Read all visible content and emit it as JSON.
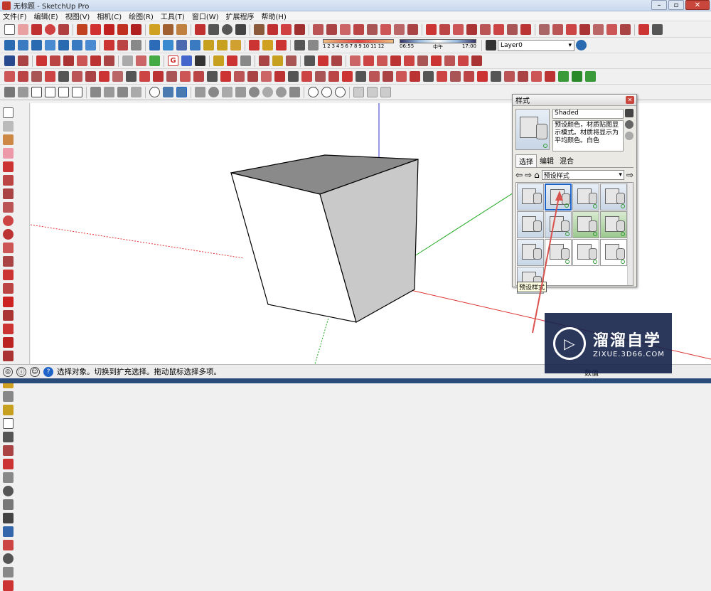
{
  "window": {
    "title": "无标题 - SketchUp Pro",
    "controls": [
      "–",
      "▫",
      "✕"
    ]
  },
  "menu": [
    "文件(F)",
    "编辑(E)",
    "视图(V)",
    "相机(C)",
    "绘图(R)",
    "工具(T)",
    "窗口(W)",
    "扩展程序",
    "帮助(H)"
  ],
  "toolbar": {
    "shadow_months": "1 2 3 4 5 6 7 8 9 10 11 12",
    "time_start": "06:55",
    "time_mid": "中午",
    "time_end": "17:00",
    "layer": "Layer0",
    "s_glyph": "G"
  },
  "panel": {
    "title": "样式",
    "style_name": "Shaded",
    "description": "预设颜色，材质贴图显示模式。材质将显示为平均颜色。白色",
    "tabs": [
      "选择",
      "编辑",
      "混合"
    ],
    "dropdown": "预设样式",
    "tooltip": "预设样式"
  },
  "status": {
    "text": "选择对象。切换到扩充选择。拖动鼠标选择多项。",
    "measure_label": "数值"
  },
  "watermark": {
    "brand": "溜溜自学",
    "url": "ZIXUE.3D66.COM"
  },
  "colors": {
    "accent": "#1e64c8",
    "axis_red": "#d33",
    "axis_green": "#2a2",
    "axis_blue": "#33c"
  }
}
